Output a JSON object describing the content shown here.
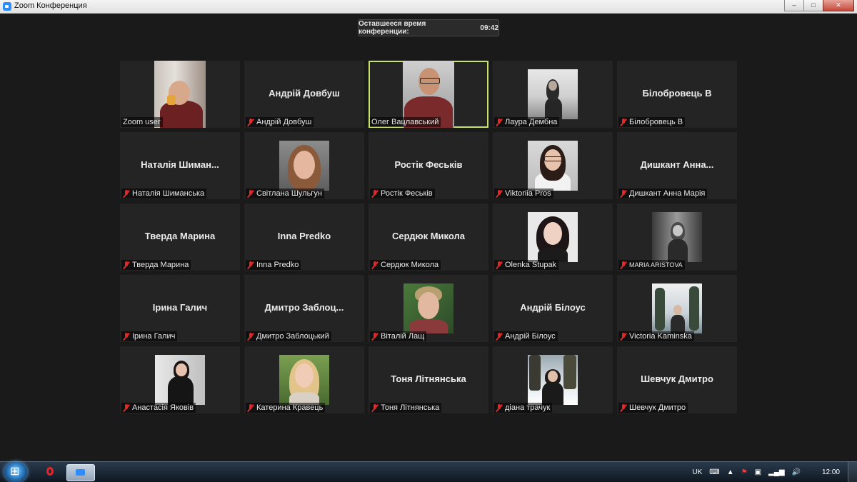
{
  "window": {
    "title": "Zoom Конференция",
    "controls": {
      "minimize": "–",
      "maximize": "□",
      "close": "✕"
    }
  },
  "timer": {
    "label": "Оставшееся время конференции:",
    "value": "09:42"
  },
  "tiles": [
    {
      "display": "",
      "label": "Zoom user",
      "muted": false,
      "video": true
    },
    {
      "display": "Андрій Довбуш",
      "label": "Андрій Довбуш",
      "muted": true,
      "video": false
    },
    {
      "display": "",
      "label": "Олег Вацлавський",
      "muted": false,
      "video": true,
      "active": true
    },
    {
      "display": "",
      "label": "Лаура Дембна",
      "muted": true,
      "video": true
    },
    {
      "display": "Білобровець В",
      "label": "Білобровець В",
      "muted": true,
      "video": false
    },
    {
      "display": "Наталія  Шиман...",
      "label": "Наталія Шиманська",
      "muted": true,
      "video": false
    },
    {
      "display": "",
      "label": "Світлана Шульгун",
      "muted": true,
      "video": true
    },
    {
      "display": "Ростік Феськів",
      "label": "Ростік Феськів",
      "muted": true,
      "video": false
    },
    {
      "display": "",
      "label": "Viktoriia Pros",
      "muted": true,
      "video": true
    },
    {
      "display": "Дишкант  Анна...",
      "label": "Дишкант Анна Марія",
      "muted": true,
      "video": false
    },
    {
      "display": "Тверда Марина",
      "label": "Тверда Марина",
      "muted": true,
      "video": false
    },
    {
      "display": "Inna Predko",
      "label": "Inna Predko",
      "muted": true,
      "video": false
    },
    {
      "display": "Сердюк Микола",
      "label": "Сердюк Микола",
      "muted": true,
      "video": false
    },
    {
      "display": "",
      "label": "Olenka Stupak",
      "muted": true,
      "video": true
    },
    {
      "display": "",
      "label": "MARIA ARISTOVA",
      "muted": true,
      "video": true
    },
    {
      "display": "Ірина Галич",
      "label": "Ірина Галич",
      "muted": true,
      "video": false
    },
    {
      "display": "Дмитро  Заблоц...",
      "label": "Дмитро Заблоцький",
      "muted": true,
      "video": false
    },
    {
      "display": "",
      "label": "Віталій Лащ",
      "muted": true,
      "video": true
    },
    {
      "display": "Андрій Білоус",
      "label": "Андрій Білоус",
      "muted": true,
      "video": false
    },
    {
      "display": "",
      "label": "Victoria Kaminska",
      "muted": true,
      "video": true
    },
    {
      "display": "",
      "label": "Анастасія Яковів",
      "muted": true,
      "video": true
    },
    {
      "display": "",
      "label": "Катерина Кравець",
      "muted": true,
      "video": true
    },
    {
      "display": "Тоня Літнянська",
      "label": "Тоня Літнянська",
      "muted": true,
      "video": false
    },
    {
      "display": "",
      "label": "діана трачук",
      "muted": true,
      "video": true
    },
    {
      "display": "Шевчук Дмитро",
      "label": "Шевчук Дмитро",
      "muted": true,
      "video": false
    }
  ],
  "taskbar": {
    "language": "UK",
    "clock": "12:00",
    "icons": [
      "keyboard-icon",
      "arrow-up-icon",
      "flag-icon",
      "network-icon",
      "signal-icon",
      "volume-icon"
    ]
  }
}
